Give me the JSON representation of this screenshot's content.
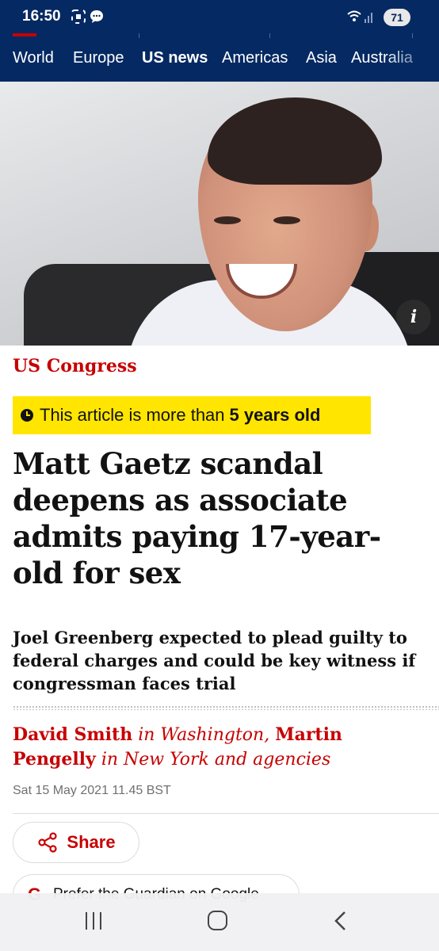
{
  "status_bar": {
    "time": "16:50",
    "battery": "71"
  },
  "nav": {
    "items": [
      "World",
      "Europe",
      "US news",
      "Americas",
      "Asia",
      "Australia"
    ],
    "active": "US news"
  },
  "hero": {
    "info_label": "i"
  },
  "article": {
    "kicker": "US Congress",
    "age_prefix": "This article is more than",
    "age_value": "5 years old",
    "headline": "Matt Gaetz scandal deepens as associate admits paying 17-year-old for sex",
    "standfirst": "Joel Greenberg expected to plead guilty to federal charges and could be key witness if congressman faces trial",
    "byline": {
      "author1": "David Smith",
      "loc1": "in Washington,",
      "author2": "Martin Pengelly",
      "loc2": "in New York and agencies"
    },
    "date": "Sat 15 May 2021 11.45 BST",
    "share_label": "Share",
    "prefer_label": "Prefer the Guardian on Google",
    "prefer_icon_letter": "G"
  },
  "colors": {
    "nav_bg": "#052962",
    "accent_red": "#c70000",
    "age_banner": "#ffe500"
  }
}
